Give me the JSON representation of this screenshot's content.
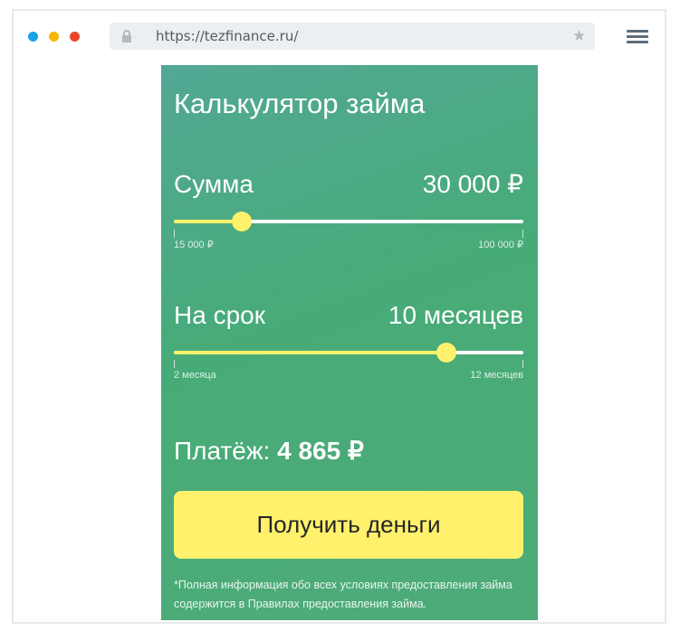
{
  "browser": {
    "url": "https://tezfinance.ru/",
    "dots": [
      "#1aa3e8",
      "#f5b800",
      "#e8472a"
    ]
  },
  "calculator": {
    "title": "Калькулятор займа",
    "amount": {
      "label": "Сумма",
      "value": "30 000 ₽",
      "min_label": "15 000 ₽",
      "max_label": "100 000 ₽",
      "fraction": 0.195
    },
    "term": {
      "label": "На срок",
      "value": "10 месяцев",
      "min_label": "2 месяца",
      "max_label": "12 месяцев",
      "fraction": 0.78
    },
    "payment": {
      "label": "Платёж:",
      "value": "4 865 ₽"
    },
    "cta_label": "Получить деньги",
    "footnote": "*Полная информация обо всех условиях предоставления займа содержится в Правилах предоставления займа."
  },
  "colors": {
    "accent": "#fff16c",
    "background_green": "#47ab78"
  },
  "icons": {
    "lock": "lock-icon",
    "star": "star-icon",
    "menu": "hamburger-menu-icon"
  }
}
